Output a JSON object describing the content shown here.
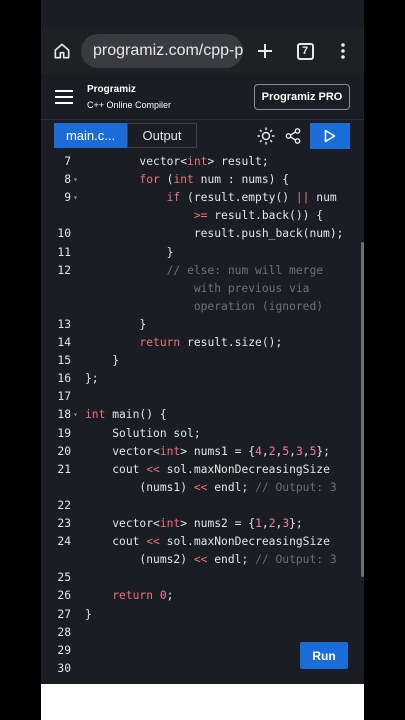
{
  "browser": {
    "url": "programiz.com/cpp-p",
    "tab_count": "7"
  },
  "site": {
    "brand": "Programiz",
    "subtitle": "C++ Online Compiler",
    "pro_label": "Programiz PRO"
  },
  "toolbar": {
    "tab_main": "main.c...",
    "tab_output": "Output"
  },
  "editor": {
    "run_label": "Run",
    "lines": [
      {
        "n": "7",
        "fold": "",
        "indent": "        ",
        "segs": [
          [
            "t",
            "vector<"
          ],
          [
            "k",
            "int"
          ],
          [
            "t",
            "> result;"
          ]
        ]
      },
      {
        "n": "8",
        "fold": "▾",
        "indent": "        ",
        "segs": [
          [
            "k",
            "for"
          ],
          [
            "t",
            " ("
          ],
          [
            "k",
            "int"
          ],
          [
            "t",
            " num : nums) {"
          ]
        ]
      },
      {
        "n": "9",
        "fold": "▾",
        "indent": "            ",
        "segs": [
          [
            "k",
            "if"
          ],
          [
            "t",
            " (result.empty() "
          ],
          [
            "k",
            "||"
          ],
          [
            "t",
            " num"
          ]
        ]
      },
      {
        "n": "",
        "fold": "",
        "indent": "                ",
        "segs": [
          [
            "k",
            ">="
          ],
          [
            "t",
            " result.back()) {"
          ]
        ]
      },
      {
        "n": "10",
        "fold": "",
        "indent": "                ",
        "segs": [
          [
            "t",
            "result.push_back(num);"
          ]
        ]
      },
      {
        "n": "11",
        "fold": "",
        "indent": "            ",
        "segs": [
          [
            "t",
            "}"
          ]
        ]
      },
      {
        "n": "12",
        "fold": "",
        "indent": "            ",
        "segs": [
          [
            "c",
            "// else: num will merge"
          ]
        ]
      },
      {
        "n": "",
        "fold": "",
        "indent": "                ",
        "segs": [
          [
            "c",
            "with previous via"
          ]
        ]
      },
      {
        "n": "",
        "fold": "",
        "indent": "                ",
        "segs": [
          [
            "c",
            "operation (ignored)"
          ]
        ]
      },
      {
        "n": "13",
        "fold": "",
        "indent": "        ",
        "segs": [
          [
            "t",
            "}"
          ]
        ]
      },
      {
        "n": "14",
        "fold": "",
        "indent": "        ",
        "segs": [
          [
            "k",
            "return"
          ],
          [
            "t",
            " result.size();"
          ]
        ]
      },
      {
        "n": "15",
        "fold": "",
        "indent": "    ",
        "segs": [
          [
            "t",
            "}"
          ]
        ]
      },
      {
        "n": "16",
        "fold": "",
        "indent": "",
        "segs": [
          [
            "t",
            "};"
          ]
        ]
      },
      {
        "n": "17",
        "fold": "",
        "indent": "",
        "segs": []
      },
      {
        "n": "18",
        "fold": "▾",
        "indent": "",
        "segs": [
          [
            "k",
            "int"
          ],
          [
            "t",
            " main() {"
          ]
        ]
      },
      {
        "n": "19",
        "fold": "",
        "indent": "    ",
        "segs": [
          [
            "t",
            "Solution sol;"
          ]
        ]
      },
      {
        "n": "20",
        "fold": "",
        "indent": "    ",
        "segs": [
          [
            "t",
            "vector<"
          ],
          [
            "k",
            "int"
          ],
          [
            "t",
            "> nums1 = {"
          ],
          [
            "n",
            "4"
          ],
          [
            "t",
            ","
          ],
          [
            "n",
            "2"
          ],
          [
            "t",
            ","
          ],
          [
            "n",
            "5"
          ],
          [
            "t",
            ","
          ],
          [
            "n",
            "3"
          ],
          [
            "t",
            ","
          ],
          [
            "n",
            "5"
          ],
          [
            "t",
            "};"
          ]
        ]
      },
      {
        "n": "21",
        "fold": "",
        "indent": "    ",
        "segs": [
          [
            "t",
            "cout "
          ],
          [
            "k",
            "<<"
          ],
          [
            "t",
            " sol.maxNonDecreasingSize"
          ]
        ]
      },
      {
        "n": "",
        "fold": "",
        "indent": "        ",
        "segs": [
          [
            "t",
            "(nums1) "
          ],
          [
            "k",
            "<<"
          ],
          [
            "t",
            " endl; "
          ],
          [
            "c",
            "// Output: 3"
          ]
        ]
      },
      {
        "n": "22",
        "fold": "",
        "indent": "",
        "segs": []
      },
      {
        "n": "23",
        "fold": "",
        "indent": "    ",
        "segs": [
          [
            "t",
            "vector<"
          ],
          [
            "k",
            "int"
          ],
          [
            "t",
            "> nums2 = {"
          ],
          [
            "n",
            "1"
          ],
          [
            "t",
            ","
          ],
          [
            "n",
            "2"
          ],
          [
            "t",
            ","
          ],
          [
            "n",
            "3"
          ],
          [
            "t",
            "};"
          ]
        ]
      },
      {
        "n": "24",
        "fold": "",
        "indent": "    ",
        "segs": [
          [
            "t",
            "cout "
          ],
          [
            "k",
            "<<"
          ],
          [
            "t",
            " sol.maxNonDecreasingSize"
          ]
        ]
      },
      {
        "n": "",
        "fold": "",
        "indent": "        ",
        "segs": [
          [
            "t",
            "(nums2) "
          ],
          [
            "k",
            "<<"
          ],
          [
            "t",
            " endl; "
          ],
          [
            "c",
            "// Output: 3"
          ]
        ]
      },
      {
        "n": "25",
        "fold": "",
        "indent": "",
        "segs": []
      },
      {
        "n": "26",
        "fold": "",
        "indent": "    ",
        "segs": [
          [
            "k",
            "return"
          ],
          [
            "t",
            " "
          ],
          [
            "n",
            "0"
          ],
          [
            "t",
            ";"
          ]
        ]
      },
      {
        "n": "27",
        "fold": "",
        "indent": "",
        "segs": [
          [
            "t",
            "}"
          ]
        ]
      },
      {
        "n": "28",
        "fold": "",
        "indent": "",
        "segs": []
      },
      {
        "n": "29",
        "fold": "",
        "indent": "",
        "segs": []
      },
      {
        "n": "30",
        "fold": "",
        "indent": "",
        "segs": []
      }
    ]
  }
}
